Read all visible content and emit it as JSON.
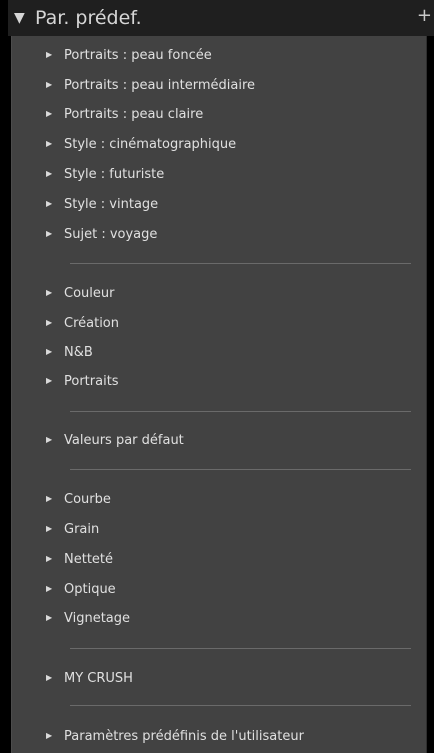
{
  "panel": {
    "title": "Par. prédef.",
    "add_icon": "+",
    "collapse_icon": "▼"
  },
  "groups": [
    {
      "items": [
        "Portraits : peau foncée",
        "Portraits : peau intermédiaire",
        "Portraits : peau claire",
        "Style : cinématographique",
        "Style : futuriste",
        "Style : vintage",
        "Sujet : voyage"
      ]
    },
    {
      "items": [
        "Couleur",
        "Création",
        "N&B",
        "Portraits"
      ]
    },
    {
      "items": [
        "Valeurs par défaut"
      ]
    },
    {
      "items": [
        "Courbe",
        "Grain",
        "Netteté",
        "Optique",
        "Vignetage"
      ]
    },
    {
      "items": [
        "MY CRUSH"
      ]
    },
    {
      "items": [
        "Paramètres prédéfinis de l'utilisateur"
      ]
    }
  ],
  "colors": {
    "panel_bg": "#424242",
    "header_bg": "#1f1f1f",
    "text": "#e0e0e0"
  },
  "icons": {
    "collapse": "triangle-down-icon",
    "expand": "triangle-right-icon",
    "add": "plus-icon"
  }
}
